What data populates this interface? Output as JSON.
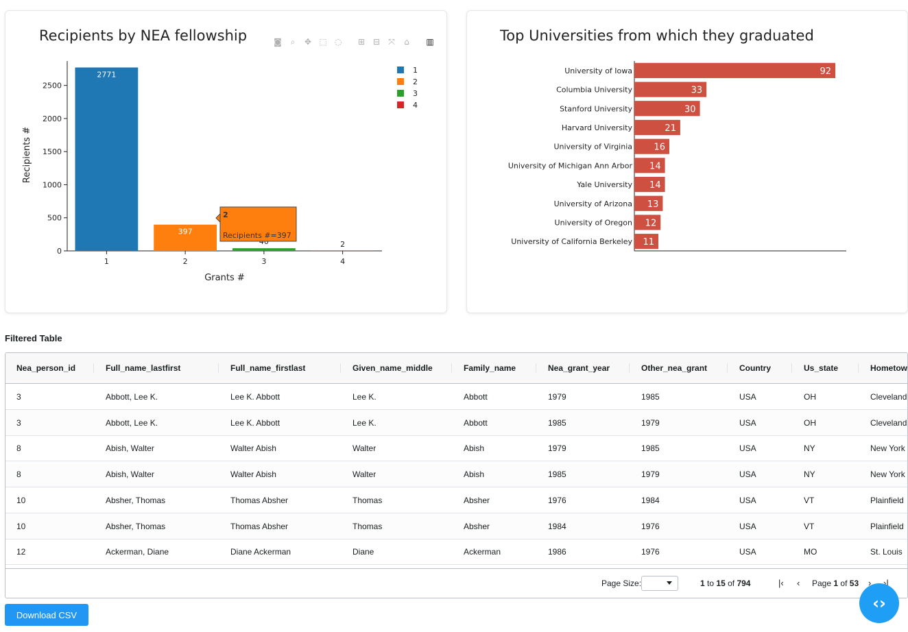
{
  "left_chart": {
    "title": "Recipients by NEA fellowship",
    "modebar": [
      "camera-icon",
      "zoom-icon",
      "pan-icon",
      "box-select-icon",
      "lasso-icon",
      "zoom-in-icon",
      "zoom-out-icon",
      "autoscale-icon",
      "reset-axes-icon",
      "plotly-logo-icon"
    ],
    "tooltip": {
      "title": "2",
      "text": "Recipients #=397"
    }
  },
  "right_chart": {
    "title": "Top Universities from which they graduated"
  },
  "chart_data": [
    {
      "type": "bar",
      "title": "Recipients by NEA fellowship",
      "xlabel": "Grants #",
      "ylabel": "Recipients #",
      "categories": [
        "1",
        "2",
        "3",
        "4"
      ],
      "values": [
        2771,
        397,
        40,
        2
      ],
      "colors": [
        "#1f77b4",
        "#ff7f0e",
        "#2ca02c",
        "#d62728"
      ],
      "ylim": [
        0,
        2900
      ],
      "yticks": [
        0,
        500,
        1000,
        1500,
        2000,
        2500
      ],
      "legend": {
        "placement": "top-right",
        "entries": [
          "1",
          "2",
          "3",
          "4"
        ]
      }
    },
    {
      "type": "bar",
      "orientation": "horizontal",
      "title": "Top Universities from which they graduated",
      "categories": [
        "University of Iowa",
        "Columbia University",
        "Stanford University",
        "Harvard University",
        "University of Virginia",
        "University of Michigan Ann Arbor",
        "Yale University",
        "University of Arizona",
        "University of Oregon",
        "University of California Berkeley"
      ],
      "values": [
        92,
        33,
        30,
        21,
        16,
        14,
        14,
        13,
        12,
        11
      ],
      "color": "#cd5040",
      "xlim": [
        0,
        97
      ]
    }
  ],
  "table": {
    "title": "Filtered Table",
    "columns": [
      "Nea_person_id",
      "Full_name_lastfirst",
      "Full_name_firstlast",
      "Given_name_middle",
      "Family_name",
      "Nea_grant_year",
      "Other_nea_grant",
      "Country",
      "Us_state",
      "Hometown"
    ],
    "rows": [
      [
        "3",
        "Abbott, Lee K.",
        "Lee K. Abbott",
        "Lee K.",
        "Abbott",
        "1979",
        "1985",
        "USA",
        "OH",
        "Cleveland"
      ],
      [
        "3",
        "Abbott, Lee K.",
        "Lee K. Abbott",
        "Lee K.",
        "Abbott",
        "1985",
        "1979",
        "USA",
        "OH",
        "Cleveland"
      ],
      [
        "8",
        "Abish, Walter",
        "Walter Abish",
        "Walter",
        "Abish",
        "1979",
        "1985",
        "USA",
        "NY",
        "New York"
      ],
      [
        "8",
        "Abish, Walter",
        "Walter Abish",
        "Walter",
        "Abish",
        "1985",
        "1979",
        "USA",
        "NY",
        "New York"
      ],
      [
        "10",
        "Absher, Thomas",
        "Thomas Absher",
        "Thomas",
        "Absher",
        "1976",
        "1984",
        "USA",
        "VT",
        "Plainfield"
      ],
      [
        "10",
        "Absher, Thomas",
        "Thomas Absher",
        "Thomas",
        "Absher",
        "1984",
        "1976",
        "USA",
        "VT",
        "Plainfield"
      ],
      [
        "12",
        "Ackerman, Diane",
        "Diane Ackerman",
        "Diane",
        "Ackerman",
        "1986",
        "1976",
        "USA",
        "MO",
        "St. Louis"
      ]
    ],
    "footer": {
      "page_size_label": "Page Size:",
      "row_from": "1",
      "to_word": "to",
      "row_to": "15",
      "of_word": "of",
      "row_total": "794",
      "page_word": "Page",
      "page_current": "1",
      "page_of": "of",
      "page_total": "53"
    }
  },
  "download_button": "Download CSV",
  "fab_icon": "code-icon",
  "fab_glyph": "‹›"
}
